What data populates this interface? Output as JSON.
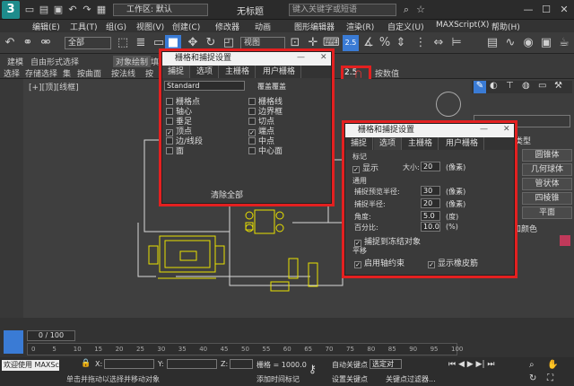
{
  "app": {
    "logo": "3",
    "workspace": "工作区: 默认",
    "title": "无标题",
    "search_placeholder": "键入关键字或短语"
  },
  "menu": [
    "编辑(E)",
    "工具(T)",
    "组(G)",
    "视图(V)",
    "创建(C)",
    "修改器",
    "动画",
    "图形编辑器",
    "渲染(R)",
    "自定义(U)",
    "MAXScript(X)",
    "帮助(H)"
  ],
  "toolbar": {
    "filter": "全部",
    "view": "视图",
    "snap_labels": [
      "2.5",
      "2",
      "3"
    ],
    "snap_label_large": "2.5"
  },
  "ribbon": {
    "tabs": [
      "建模",
      "自由形式",
      "选择",
      "对象绘制",
      "填充"
    ],
    "tools": [
      "选择",
      "存储选择",
      "集",
      "按曲面",
      "按法线",
      "按"
    ],
    "right_tool": "按数值"
  },
  "viewport": {
    "label": "[+][顶][线框]"
  },
  "dlg1": {
    "title": "栅格和捕捉设置",
    "tabs": [
      "捕捉",
      "选项",
      "主栅格",
      "用户栅格"
    ],
    "dropdown": "Standard",
    "override": "覆盖覆盖",
    "left": [
      {
        "label": "栅格点",
        "checked": false
      },
      {
        "label": "轴心",
        "checked": false
      },
      {
        "label": "垂足",
        "checked": false
      },
      {
        "label": "顶点",
        "checked": true
      },
      {
        "label": "边/线段",
        "checked": false
      },
      {
        "label": "面",
        "checked": false
      }
    ],
    "right": [
      {
        "label": "栅格线",
        "checked": false
      },
      {
        "label": "边界框",
        "checked": false
      },
      {
        "label": "切点",
        "checked": false
      },
      {
        "label": "端点",
        "checked": true
      },
      {
        "label": "中点",
        "checked": false
      },
      {
        "label": "中心面",
        "checked": false
      }
    ],
    "clear": "清除全部"
  },
  "dlg2": {
    "title": "栅格和捕捉设置",
    "tabs": [
      "捕捉",
      "选项",
      "主栅格",
      "用户栅格"
    ],
    "mark_section": "标记",
    "show": "显示",
    "size_label": "大小:",
    "size_val": "20",
    "size_unit": "(像素)",
    "general": "通用",
    "preview_radius": "捕捉预览半径:",
    "preview_val": "30",
    "preview_unit": "(像素)",
    "snap_radius": "捕捉半径:",
    "snap_val": "20",
    "snap_unit": "(像素)",
    "angle": "角度:",
    "angle_val": "5.0",
    "angle_unit": "(度)",
    "percent": "百分比:",
    "percent_val": "10.0",
    "percent_unit": "(%)",
    "snap_frozen": "捕捉到冻结对象",
    "translate": "平移",
    "axis": "启用轴约束",
    "rubber": "显示橡皮筋"
  },
  "cmd": {
    "dropdown": "",
    "type_header": "类型",
    "buttons": [
      "圆锥体",
      "几何球体",
      "管状体",
      "四棱锥",
      "平面"
    ],
    "color_label": "和颜色"
  },
  "timeline": {
    "frame": "0 / 100",
    "ticks": [
      "0",
      "5",
      "10",
      "15",
      "20",
      "25",
      "30",
      "35",
      "40",
      "45",
      "50",
      "55",
      "60",
      "65",
      "70",
      "75",
      "80",
      "85",
      "90",
      "95",
      "100"
    ]
  },
  "status": {
    "welcome": "欢迎使用 MAXSc",
    "prompt": "单击并拖动以选择并移动对象",
    "x": "X:",
    "y": "Y:",
    "z": "Z:",
    "grid": "栅格 = 1000.0",
    "add_time": "添加时间标记",
    "autokey": "自动关键点",
    "selected": "选定对",
    "setkey": "设置关键点",
    "filter": "关键点过滤器..."
  },
  "colors": {
    "accent_red": "#e32020",
    "snap_blue": "#3a7bd5",
    "drawing_yellow": "#e8e000"
  }
}
